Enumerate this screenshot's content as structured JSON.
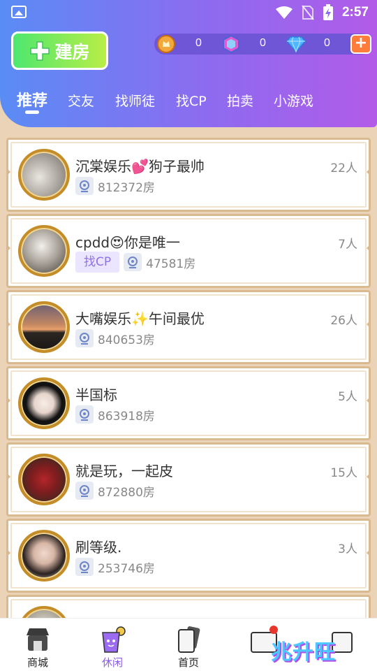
{
  "status_bar": {
    "time": "2:57"
  },
  "header": {
    "build_button_label": "建房",
    "currency": {
      "coins": "0",
      "gems": "0",
      "diamonds": "0"
    },
    "add_label": "+"
  },
  "tabs": [
    {
      "label": "推荐"
    },
    {
      "label": "交友"
    },
    {
      "label": "找师徒"
    },
    {
      "label": "找CP"
    },
    {
      "label": "拍卖"
    },
    {
      "label": "小游戏"
    }
  ],
  "rooms": [
    {
      "title": "沉棠娱乐💕狗子最帅",
      "count": "22人",
      "room_id": "812372房",
      "tag": ""
    },
    {
      "title": "cpdd😍你是唯一",
      "count": "7人",
      "room_id": "47581房",
      "tag": "找CP"
    },
    {
      "title": "大嘴娱乐✨午间最优",
      "count": "26人",
      "room_id": "840653房",
      "tag": ""
    },
    {
      "title": "半国标",
      "count": "5人",
      "room_id": "863918房",
      "tag": ""
    },
    {
      "title": "就是玩，一起皮",
      "count": "15人",
      "room_id": "872880房",
      "tag": ""
    },
    {
      "title": "刷等级.",
      "count": "3人",
      "room_id": "253746房",
      "tag": ""
    },
    {
      "title": "",
      "count": "",
      "room_id": "",
      "tag": ""
    }
  ],
  "bottom_nav": [
    {
      "label": "商城"
    },
    {
      "label": "休闲"
    },
    {
      "label": "首页"
    }
  ],
  "watermark": "兆升旺",
  "colors": {
    "accent": "#8a5be6",
    "build_button": "#4ee76f",
    "card_border": "#d9b98f",
    "avatar_ring": "#c58d27"
  }
}
